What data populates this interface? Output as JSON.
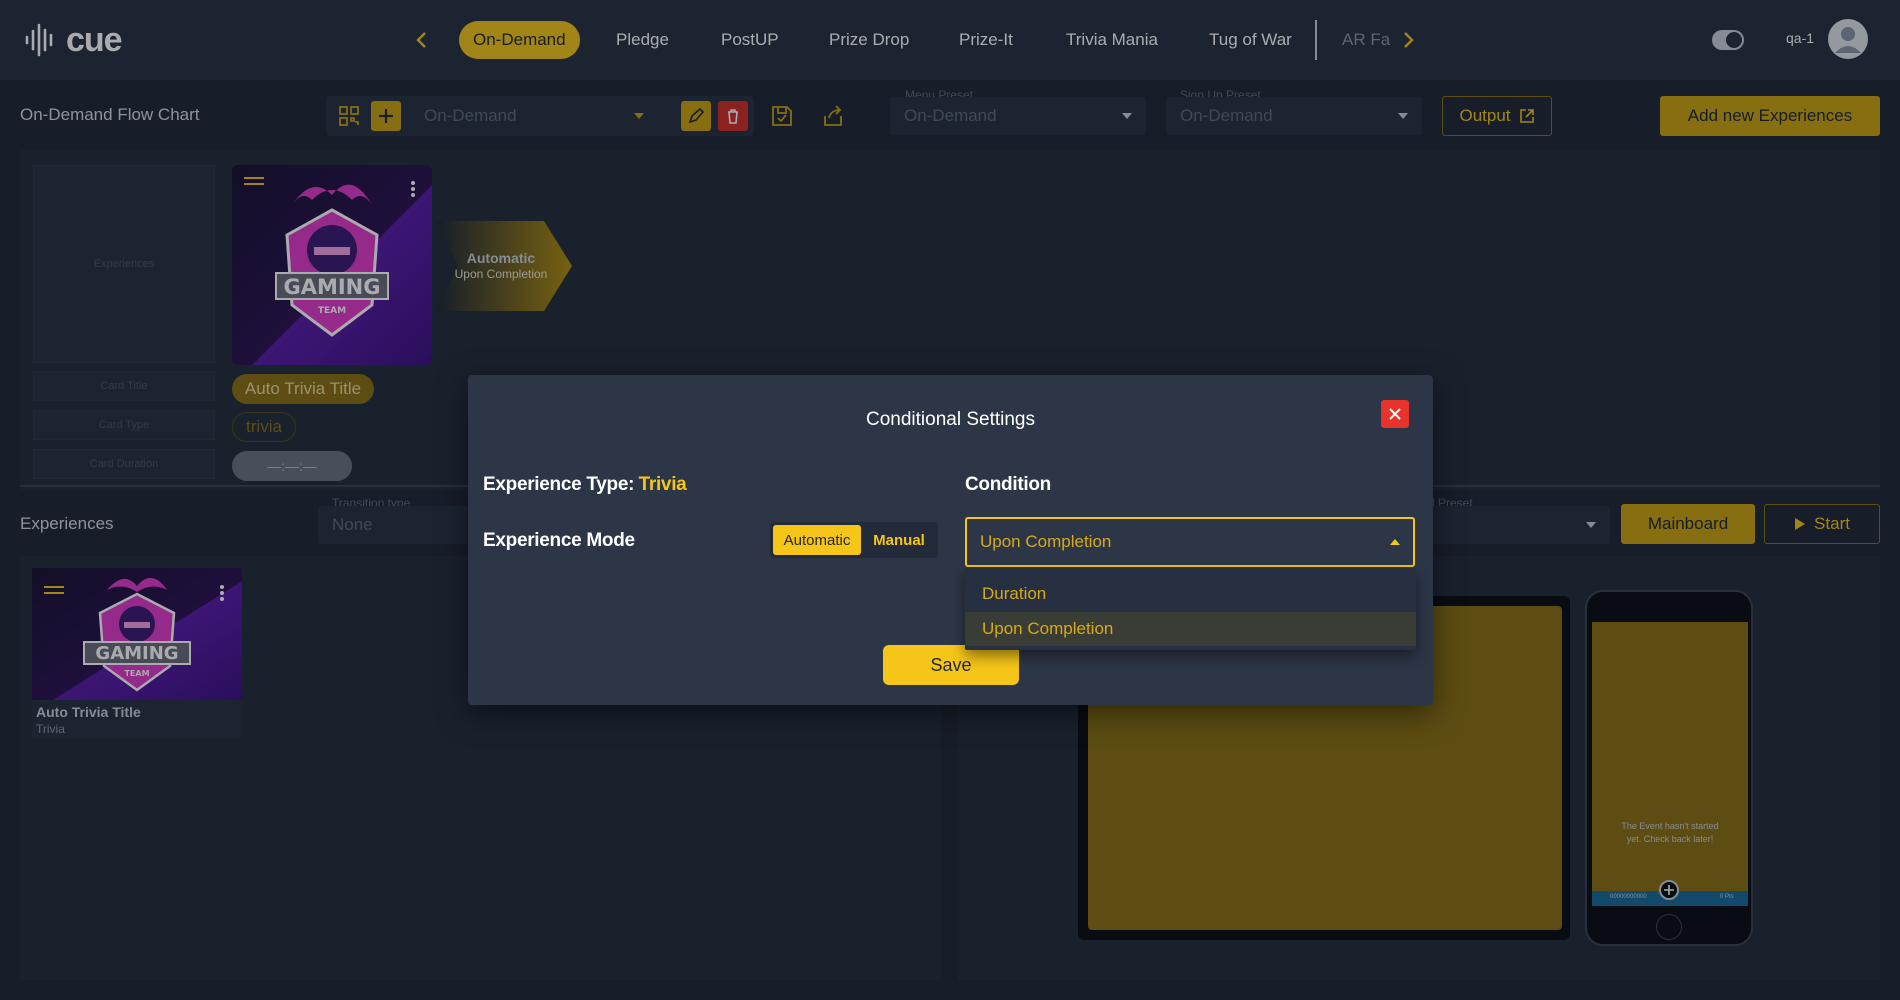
{
  "header": {
    "logo_text": "cue",
    "tabs": [
      {
        "label": "On-Demand",
        "active": true
      },
      {
        "label": "Pledge"
      },
      {
        "label": "PostUP"
      },
      {
        "label": "Prize Drop"
      },
      {
        "label": "Prize-It"
      },
      {
        "label": "Trivia Mania"
      },
      {
        "label": "Tug of War"
      },
      {
        "label": "AR Fa"
      }
    ],
    "user_name": "qa-1"
  },
  "toolbar": {
    "page_title": "On-Demand Flow Chart",
    "flow_select": "On-Demand",
    "menu_preset_label": "Menu Preset",
    "menu_preset_value": "On-Demand",
    "signup_preset_label": "Sign Up Preset",
    "signup_preset_value": "On-Demand",
    "output_label": "Output",
    "add_label": "Add new Experiences"
  },
  "flow": {
    "placeholder_box": "Experiences",
    "placeholder_title": "Card Title",
    "placeholder_type": "Card Type",
    "placeholder_duration": "Card Duration",
    "card_title": "Auto Trivia Title",
    "card_type": "trivia",
    "card_duration": "—:—:—",
    "arrow_mode": "Automatic",
    "arrow_condition": "Upon Completion"
  },
  "experiences": {
    "section_label": "Experiences",
    "transition_label": "Transition type",
    "transition_value": "None",
    "preset_label_fragment": "d Preset",
    "mainboard_label": "Mainboard",
    "start_label": "Start",
    "item_title": "Auto Trivia Title",
    "item_type": "Trivia",
    "phone_message": "The Event hasn't started yet. Check back later!",
    "phone_footer_left": "00000000000",
    "phone_footer_right": "0 Pts"
  },
  "modal": {
    "title": "Conditional Settings",
    "experience_type_label": "Experience Type:",
    "experience_type_value": "Trivia",
    "experience_mode_label": "Experience Mode",
    "mode_automatic": "Automatic",
    "mode_manual": "Manual",
    "condition_label": "Condition",
    "condition_value": "Upon Completion",
    "options": [
      "Duration",
      "Upon Completion"
    ],
    "save_label": "Save"
  },
  "colors": {
    "accent": "#f5c518",
    "background": "#1f2634",
    "panel": "#2d3647",
    "danger": "#e8322c"
  }
}
